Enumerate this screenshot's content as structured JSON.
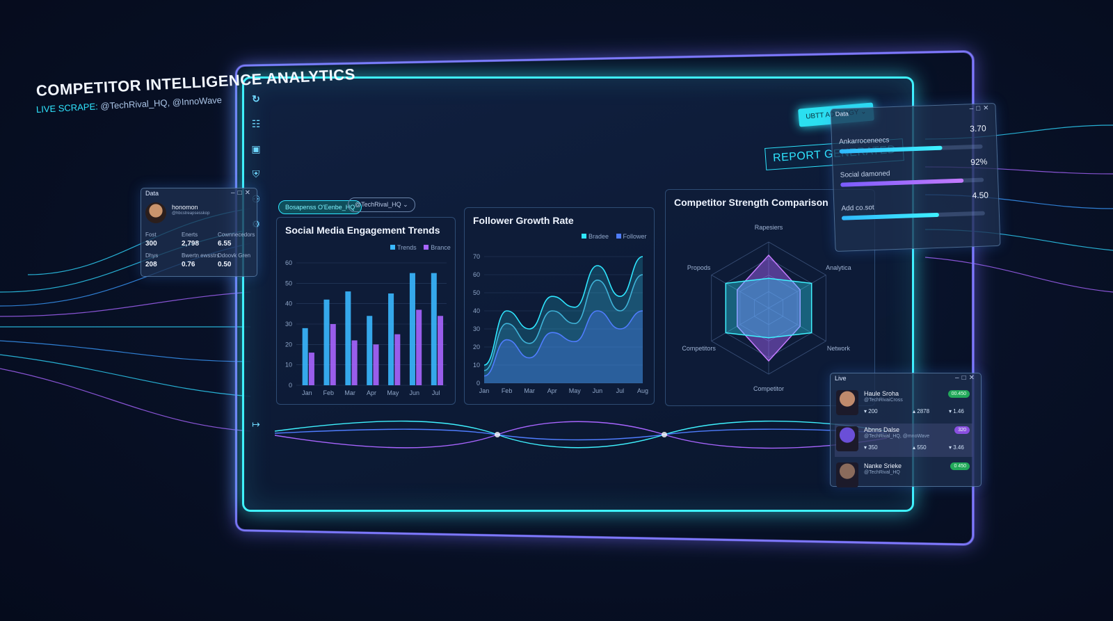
{
  "header": {
    "title": "COMPETITOR INTELLIGENCE ANALYTICS",
    "scrape_label": "LIVE SCRAPE:",
    "scrape_handles": "@TechRival_HQ, @InnoWave"
  },
  "filters": {
    "chip1": "Bosapenss O'Eenbe_HQ",
    "chip2": "@TechRival_HQ"
  },
  "topbar": {
    "dropdown": "UBTT ADALOGY",
    "report": "REPORT GENERATED"
  },
  "sidebar": {
    "icons": [
      "logo-icon",
      "dashboard-icon",
      "calendar-icon",
      "shield-icon",
      "users-icon",
      "gear-icon",
      "logout-icon"
    ]
  },
  "engagement": {
    "title": "Social Media Engagement Trends",
    "legend": [
      "Trends",
      "Brance"
    ]
  },
  "growth": {
    "title": "Follower Growth Rate",
    "legend": [
      "Bradee",
      "Follower"
    ]
  },
  "radar": {
    "title": "Competitor Strength Comparison",
    "axes": [
      "Rapesiers",
      "Analytica",
      "Network",
      "Competitor",
      "Competitors",
      "Propods"
    ]
  },
  "profile_window": {
    "title": "Data",
    "name": "honomon",
    "handle": "@hbcstreapsesskop",
    "stats": [
      {
        "label": "Fost",
        "value": "300"
      },
      {
        "label": "Enerts",
        "value": "2,798"
      },
      {
        "label": "Cownnecedors",
        "value": "6.55"
      },
      {
        "label": "Dhys",
        "value": "208"
      },
      {
        "label": "Bwertn ewsstrs",
        "value": "0.76"
      },
      {
        "label": "Ddoovk Gren",
        "value": "0.50"
      }
    ]
  },
  "data_window": {
    "title": "Data",
    "rows": [
      {
        "label": "Ankarroceneecs",
        "value": "3.70",
        "pct": 0.72
      },
      {
        "label": "Social damoned",
        "value": "92%",
        "pct": 0.86
      },
      {
        "label": "Add co.sot",
        "value": "4.50",
        "pct": 0.68
      }
    ]
  },
  "live_window": {
    "title": "Live",
    "rows": [
      {
        "name": "Haule Sroha",
        "handle": "@TechRivaiCross",
        "a": "200",
        "b": "2878",
        "c": "1.46",
        "badge": "00.450"
      },
      {
        "name": "Abnns Dalse",
        "handle": "@TechRival_HQ, @mnoWave",
        "a": "350",
        "b": "550",
        "c": "3.46",
        "badge": "320"
      },
      {
        "name": "Nanke Srieke",
        "handle": "@TechRival_HQ",
        "a": "",
        "b": "",
        "c": "",
        "badge": "0 450"
      }
    ]
  },
  "colors": {
    "cyan": "#3ff2ff",
    "purple": "#a865ff",
    "blue": "#3f7dff"
  },
  "chart_data": [
    {
      "type": "bar",
      "title": "Social Media Engagement Trends",
      "categories": [
        "Jan",
        "Feb",
        "Mar",
        "Apr",
        "May",
        "Jun",
        "Jul"
      ],
      "series": [
        {
          "name": "Trends",
          "values": [
            28,
            42,
            46,
            34,
            45,
            55,
            55
          ]
        },
        {
          "name": "Brance",
          "values": [
            16,
            30,
            22,
            20,
            25,
            37,
            34
          ]
        }
      ],
      "ylim": [
        0,
        60
      ],
      "yticks": [
        0,
        10,
        20,
        30,
        40,
        50,
        60
      ]
    },
    {
      "type": "area",
      "title": "Follower Growth Rate",
      "x": [
        "Jan",
        "Feb",
        "Mar",
        "Apr",
        "May",
        "Jun",
        "Jul",
        "Aug"
      ],
      "series": [
        {
          "name": "Bradee",
          "values": [
            10,
            40,
            30,
            48,
            42,
            65,
            48,
            70
          ]
        },
        {
          "name": "Follower",
          "values": [
            7,
            33,
            22,
            40,
            33,
            57,
            40,
            60
          ]
        },
        {
          "name": "",
          "values": [
            4,
            24,
            14,
            28,
            23,
            40,
            30,
            40
          ]
        }
      ],
      "ylim": [
        0,
        70
      ],
      "yticks": [
        0,
        10,
        20,
        30,
        40,
        50,
        60,
        70
      ]
    },
    {
      "type": "radar",
      "title": "Competitor Strength Comparison",
      "axes": [
        "Rapesiers",
        "Analytica",
        "Network",
        "Competitor",
        "Competitors",
        "Propods"
      ],
      "series": [
        {
          "name": "",
          "values": [
            0.8,
            0.55,
            0.55,
            0.8,
            0.55,
            0.55
          ]
        },
        {
          "name": "",
          "values": [
            0.45,
            0.75,
            0.75,
            0.45,
            0.75,
            0.75
          ]
        }
      ]
    }
  ]
}
